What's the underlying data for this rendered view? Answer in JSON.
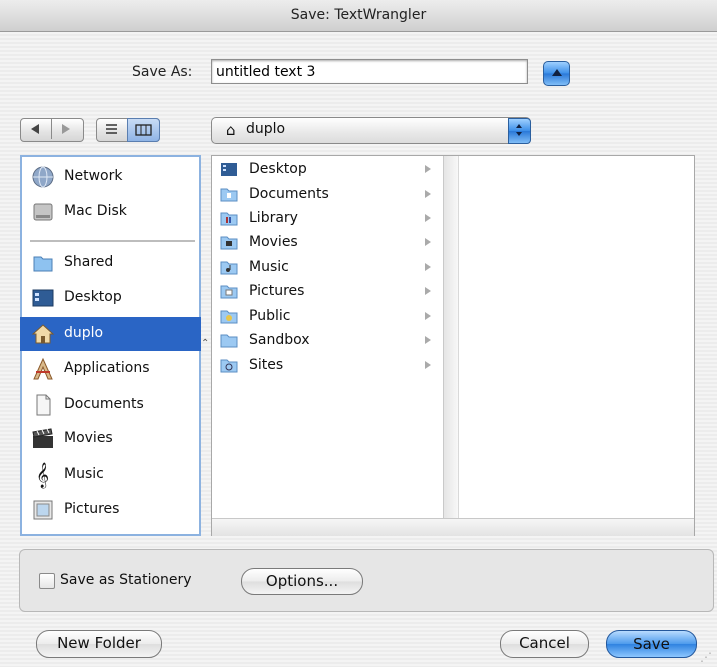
{
  "window": {
    "title": "Save: TextWrangler"
  },
  "save_as": {
    "label": "Save As:",
    "value": "untitled text 3"
  },
  "path_popup": {
    "selected": "duplo"
  },
  "sidebar": {
    "items": [
      {
        "label": "Network",
        "icon": "globe-icon"
      },
      {
        "label": "Mac Disk",
        "icon": "hard-disk-icon"
      },
      {
        "label": "Shared",
        "icon": "folder-icon"
      },
      {
        "label": "Desktop",
        "icon": "desktop-icon"
      },
      {
        "label": "duplo",
        "icon": "home-icon",
        "selected": true
      },
      {
        "label": "Applications",
        "icon": "applications-icon"
      },
      {
        "label": "Documents",
        "icon": "document-icon"
      },
      {
        "label": "Movies",
        "icon": "clapperboard-icon"
      },
      {
        "label": "Music",
        "icon": "music-icon"
      },
      {
        "label": "Pictures",
        "icon": "picture-frame-icon"
      }
    ]
  },
  "column": {
    "items": [
      {
        "label": "Desktop",
        "icon": "desktop-folder-icon"
      },
      {
        "label": "Documents",
        "icon": "documents-folder-icon"
      },
      {
        "label": "Library",
        "icon": "library-folder-icon"
      },
      {
        "label": "Movies",
        "icon": "movies-folder-icon"
      },
      {
        "label": "Music",
        "icon": "music-folder-icon"
      },
      {
        "label": "Pictures",
        "icon": "pictures-folder-icon"
      },
      {
        "label": "Public",
        "icon": "public-folder-icon"
      },
      {
        "label": "Sandbox",
        "icon": "folder-icon"
      },
      {
        "label": "Sites",
        "icon": "sites-folder-icon"
      }
    ]
  },
  "bottom": {
    "stationery_label": "Save as Stationery",
    "stationery_checked": false,
    "options_label": "Options...",
    "new_folder_label": "New Folder",
    "cancel_label": "Cancel",
    "save_label": "Save"
  },
  "colors": {
    "selection": "#2a65c5",
    "accent": "#3b8ee8"
  }
}
